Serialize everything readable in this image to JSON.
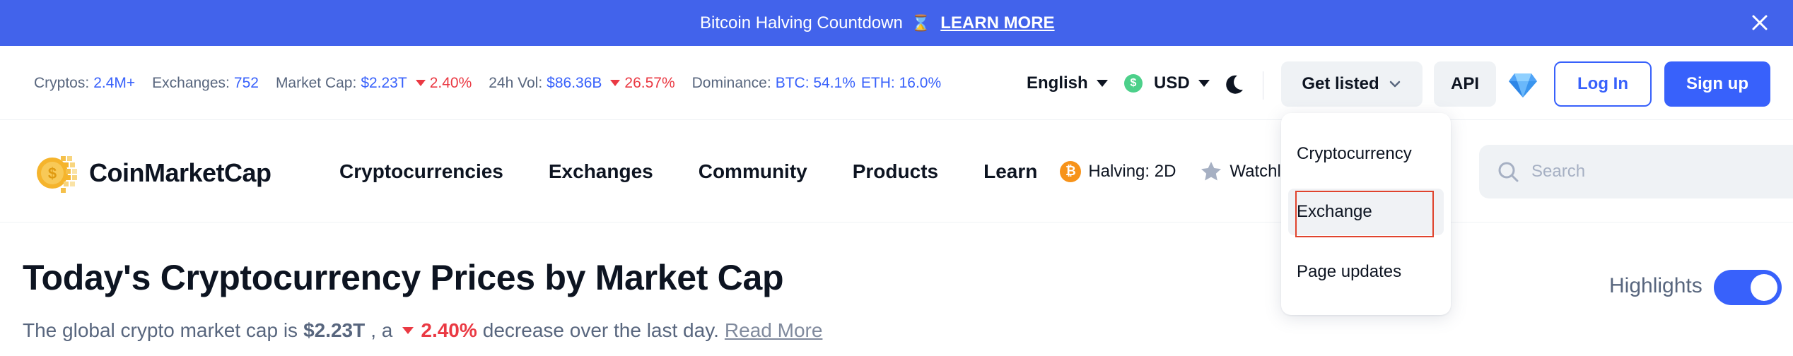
{
  "banner": {
    "text": "Bitcoin Halving Countdown",
    "icon": "hourglass-icon",
    "link_label": "LEARN MORE"
  },
  "stats": {
    "cryptos_label": "Cryptos:",
    "cryptos_value": "2.4M+",
    "exchanges_label": "Exchanges:",
    "exchanges_value": "752",
    "marketcap_label": "Market Cap:",
    "marketcap_value": "$2.23T",
    "marketcap_change": "2.40%",
    "vol_label": "24h Vol:",
    "vol_value": "$86.36B",
    "vol_change": "26.57%",
    "dominance_label": "Dominance:",
    "dominance_btc": "BTC: 54.1%",
    "dominance_eth": "ETH: 16.0%"
  },
  "topbar": {
    "language": "English",
    "currency": "USD",
    "currency_symbol": "$",
    "get_listed": "Get listed",
    "api": "API",
    "login": "Log In",
    "signup": "Sign up"
  },
  "nav": {
    "logo_text": "CoinMarketCap",
    "links": [
      "Cryptocurrencies",
      "Exchanges",
      "Community",
      "Products",
      "Learn"
    ],
    "halving": "Halving: 2D",
    "watchlist": "Watchlist",
    "search_placeholder": "Search"
  },
  "dropdown": {
    "items": [
      "Cryptocurrency",
      "Exchange",
      "Page updates"
    ]
  },
  "page": {
    "title": "Today's Cryptocurrency Prices by Market Cap",
    "sub_prefix": "The global crypto market cap is",
    "sub_value": "$2.23T",
    "sub_mid": ", a",
    "sub_pct": "2.40%",
    "sub_suffix": "decrease over the last day.",
    "read_more": "Read More",
    "highlights_label": "Highlights",
    "highlights_on": true
  },
  "colors": {
    "brand": "#3861fb",
    "banner": "#4263eb",
    "negative": "#ea3943",
    "highlight_box": "#e0432d"
  }
}
